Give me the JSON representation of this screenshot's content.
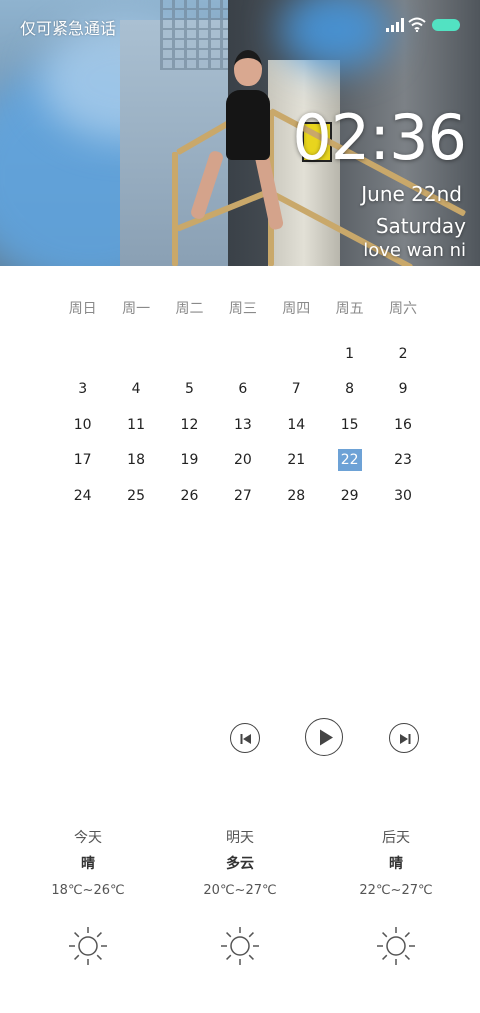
{
  "statusbar": {
    "emergency_text": "仅可紧急通话",
    "signal_icon": "signal-icon",
    "wifi_icon": "wifi-icon",
    "battery_icon": "battery-icon",
    "battery_color": "#52e2c2"
  },
  "lockscreen": {
    "time": "02:36",
    "date": "June  22nd",
    "weekday": "Saturday",
    "signature": "love wan ni"
  },
  "calendar": {
    "weekday_headers": [
      "周日",
      "周一",
      "周二",
      "周三",
      "周四",
      "周五",
      "周六"
    ],
    "weeks": [
      [
        "",
        "",
        "",
        "",
        "",
        "1",
        "2"
      ],
      [
        "3",
        "4",
        "5",
        "6",
        "7",
        "8",
        "9"
      ],
      [
        "10",
        "11",
        "12",
        "13",
        "14",
        "15",
        "16"
      ],
      [
        "17",
        "18",
        "19",
        "20",
        "21",
        "22",
        "23"
      ],
      [
        "24",
        "25",
        "26",
        "27",
        "28",
        "29",
        "30"
      ]
    ],
    "today": "22",
    "today_color": "#6da2d6"
  },
  "media": {
    "prev_icon": "skip-previous-icon",
    "play_icon": "play-icon",
    "next_icon": "skip-next-icon"
  },
  "weather": [
    {
      "day": "今天",
      "condition": "晴",
      "temp": "18℃~26℃",
      "icon": "sun-icon"
    },
    {
      "day": "明天",
      "condition": "多云",
      "temp": "20℃~27℃",
      "icon": "sun-icon"
    },
    {
      "day": "后天",
      "condition": "晴",
      "temp": "22℃~27℃",
      "icon": "sun-icon"
    }
  ]
}
